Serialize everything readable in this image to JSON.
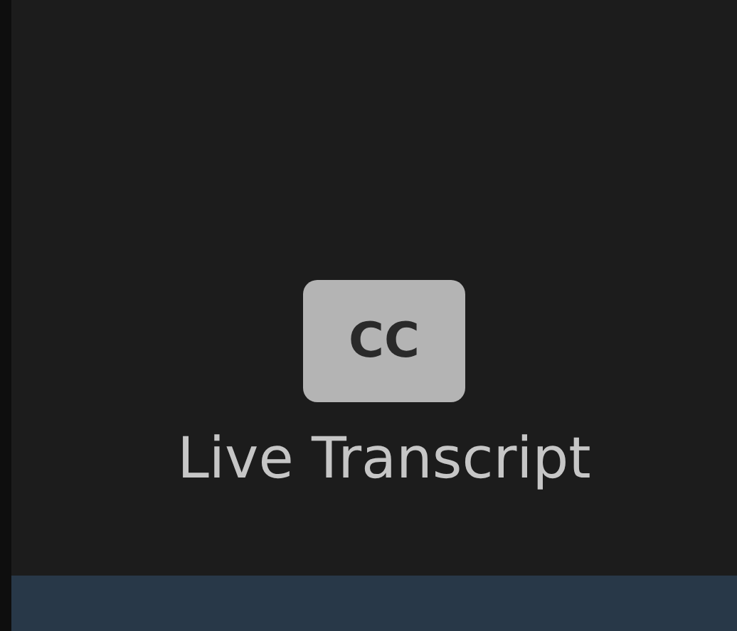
{
  "cc_button": {
    "label": "CC"
  },
  "caption": "Live Transcript"
}
